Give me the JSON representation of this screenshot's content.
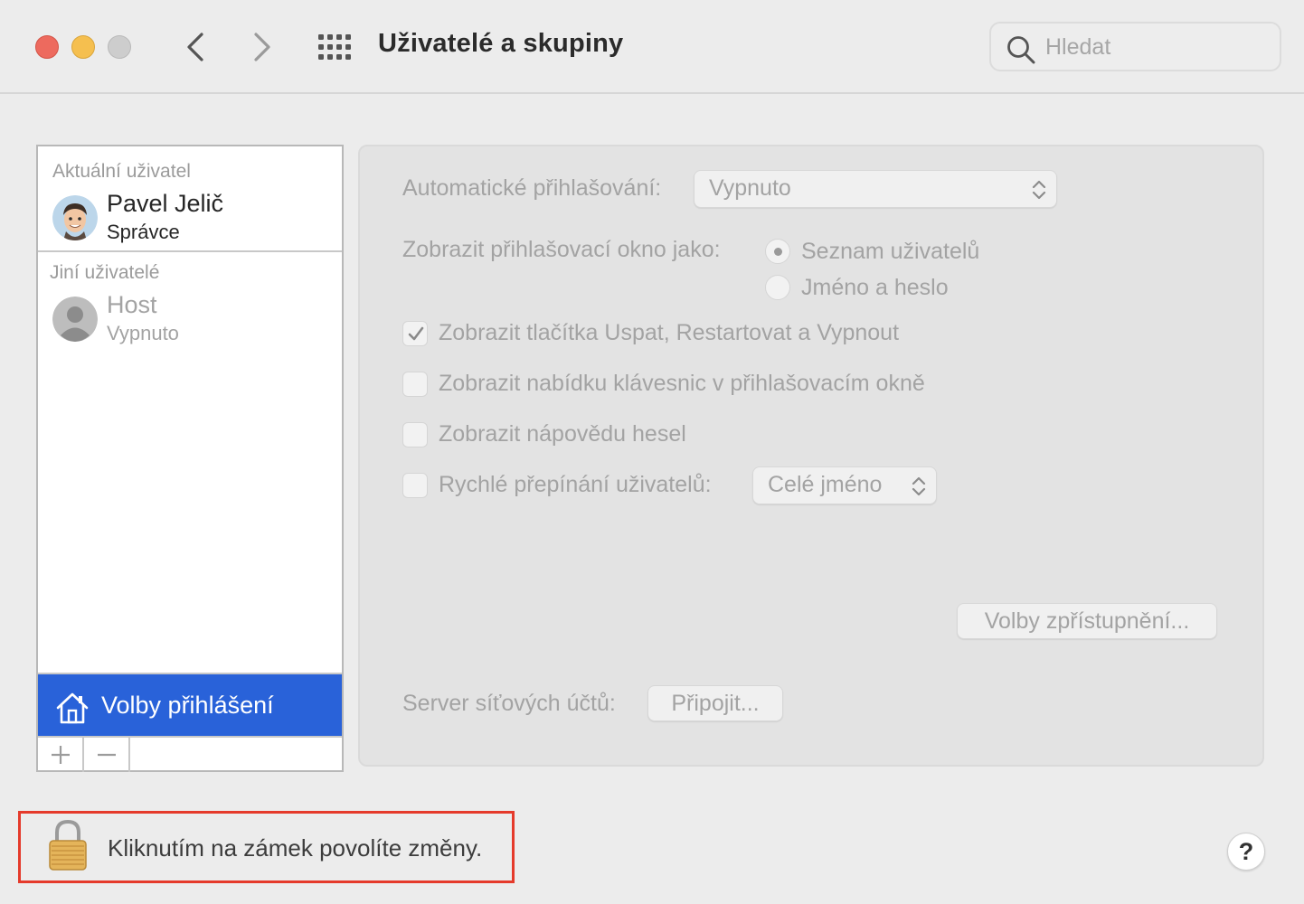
{
  "window": {
    "title": "Uživatelé a skupiny",
    "search_placeholder": "Hledat"
  },
  "sidebar": {
    "current_header": "Aktuální uživatel",
    "current_user": {
      "name": "Pavel Jelič",
      "role": "Správce"
    },
    "others_header": "Jiní uživatelé",
    "other_users": [
      {
        "name": "Host",
        "status": "Vypnuto"
      }
    ],
    "login_options_label": "Volby přihlášení",
    "selected_color": "#2962d9"
  },
  "panel": {
    "auto_login_label": "Automatické přihlašování:",
    "auto_login_value": "Vypnuto",
    "display_login_label": "Zobrazit přihlašovací okno jako:",
    "display_options": [
      {
        "label": "Seznam uživatelů",
        "selected": true
      },
      {
        "label": "Jméno a heslo",
        "selected": false
      }
    ],
    "checkboxes": [
      {
        "label": "Zobrazit tlačítka Uspat, Restartovat a Vypnout",
        "checked": true
      },
      {
        "label": "Zobrazit nabídku klávesnic v přihlašovacím okně",
        "checked": false
      },
      {
        "label": "Zobrazit nápovědu hesel",
        "checked": false
      },
      {
        "label": "Rychlé přepínání uživatelů:",
        "checked": false
      }
    ],
    "fast_switch_value": "Celé jméno",
    "accessibility_button": "Volby zpřístupnění...",
    "network_server_label": "Server síťových účtů:",
    "connect_button": "Připojit..."
  },
  "footer": {
    "lock_text": "Kliknutím na zámek povolíte změny.",
    "help_label": "?",
    "highlight_color": "#e53a2b"
  }
}
